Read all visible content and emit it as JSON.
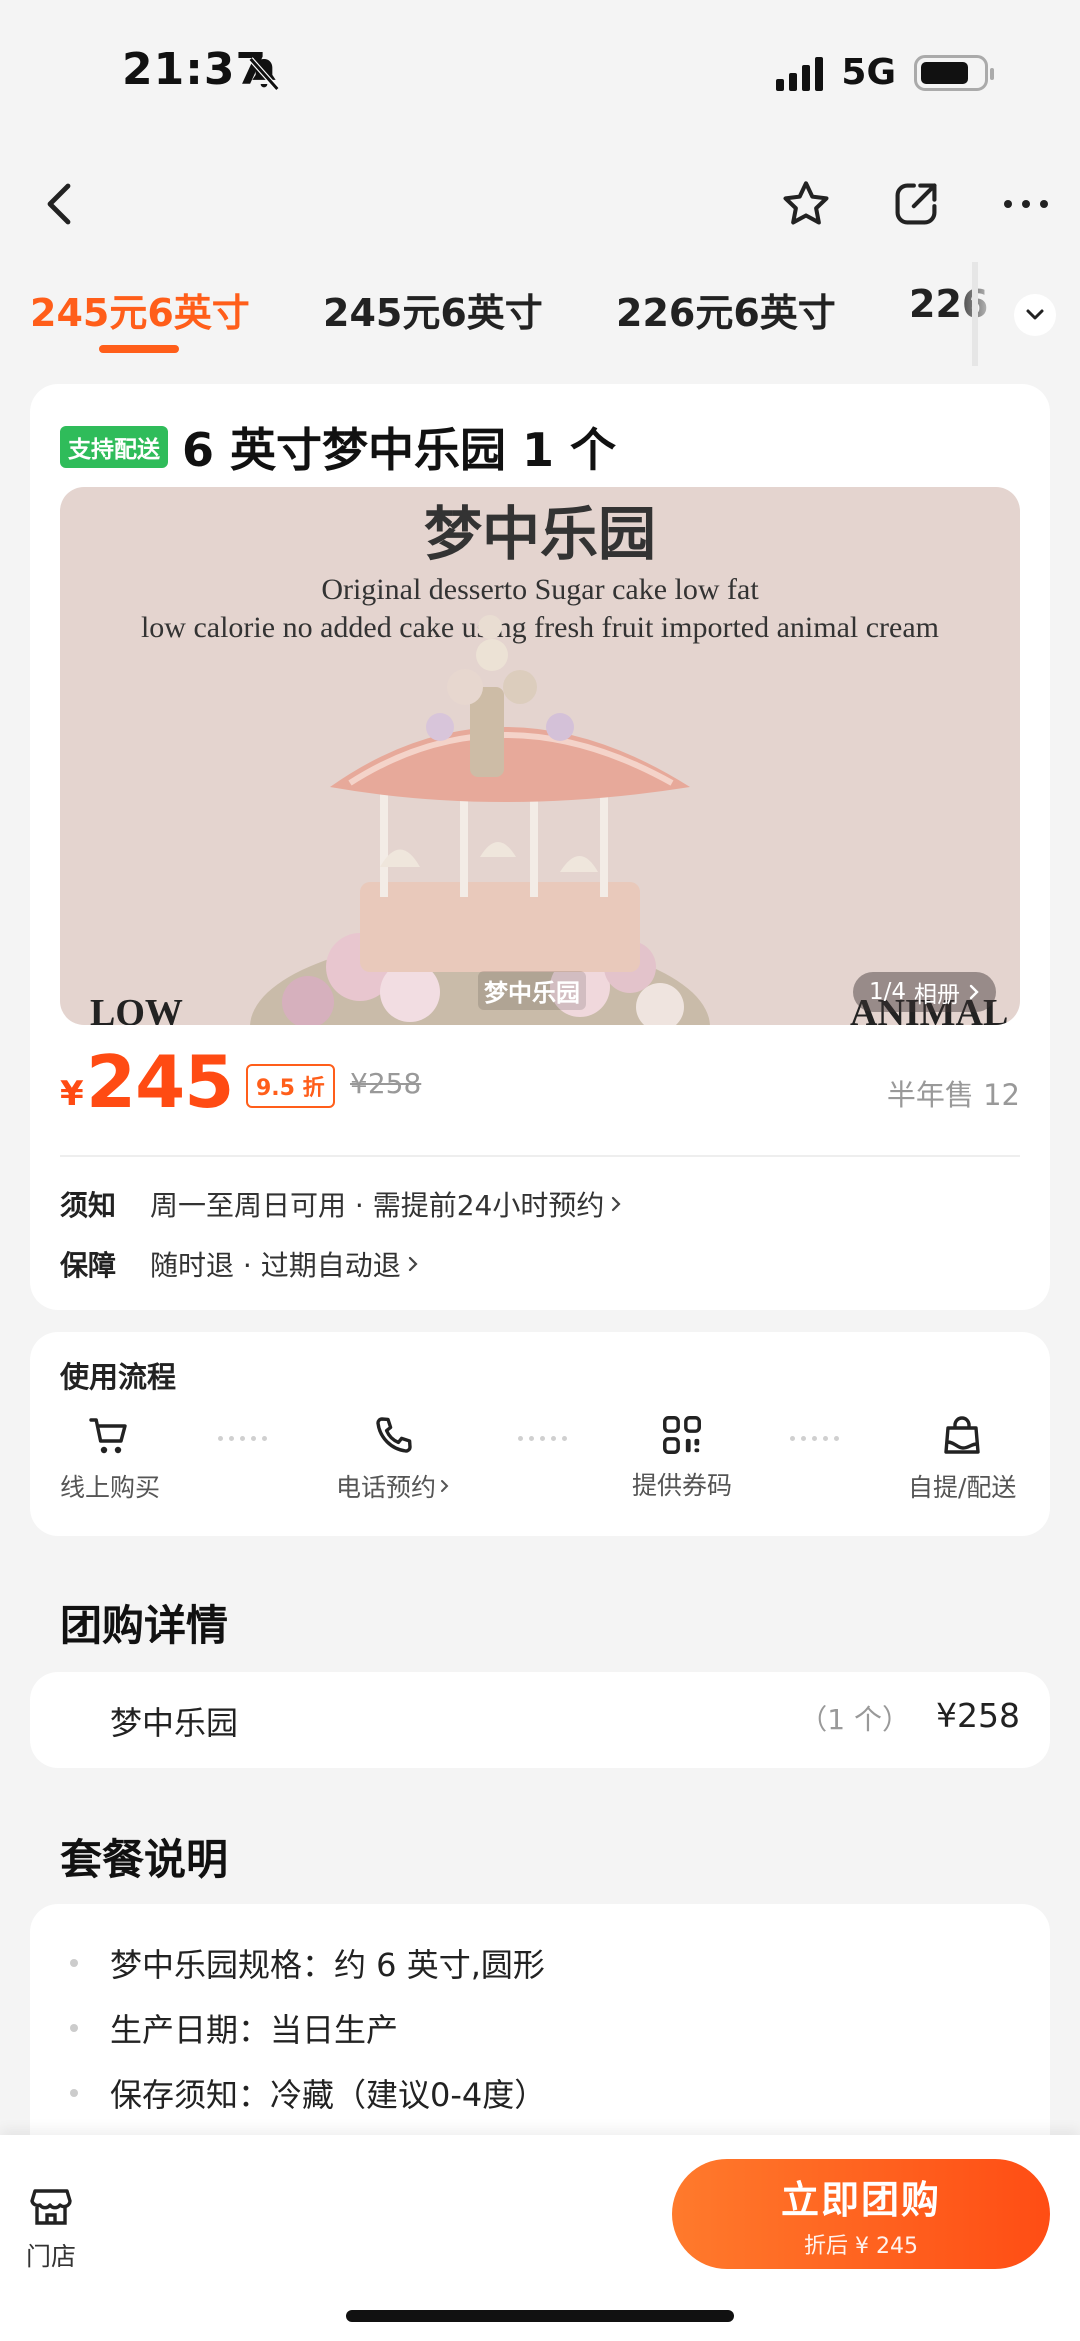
{
  "status_bar": {
    "time": "21:37",
    "network": "5G",
    "battery_level": 0.78
  },
  "tabs": [
    {
      "label": "245元6英寸",
      "active": true
    },
    {
      "label": "245元6英寸",
      "active": false
    },
    {
      "label": "226元6英寸",
      "active": false
    },
    {
      "label": "226",
      "active": false
    }
  ],
  "deal": {
    "tag": "支持配送",
    "title": "6 英寸梦中乐园 1 个",
    "image": {
      "title": "梦中乐园",
      "subtitle_line1": "Original desserto Sugar cake low fat",
      "subtitle_line2": "low calorie no added cake using fresh fruit imported animal cream",
      "corner_left": "LOW",
      "corner_right": "ANIMAL",
      "caption": "梦中乐园",
      "album_index": "1/4",
      "album_label": "相册"
    },
    "currency": "¥",
    "price": "245",
    "discount": "9.5 折",
    "original_price": "¥258",
    "sold": "半年售 12",
    "notice_label": "须知",
    "notice_text": "周一至周日可用 · 需提前24小时预约",
    "guarantee_label": "保障",
    "guarantee_text": "随时退 · 过期自动退"
  },
  "flow": {
    "title": "使用流程",
    "steps": [
      {
        "label": "线上购买",
        "icon": "cart-icon"
      },
      {
        "label": "电话预约",
        "icon": "phone-icon"
      },
      {
        "label": "提供券码",
        "icon": "qr-code-icon"
      },
      {
        "label": "自提/配送",
        "icon": "bag-icon"
      }
    ]
  },
  "group_detail": {
    "title": "团购详情",
    "item_name": "梦中乐园",
    "item_qty": "（1 个）",
    "item_price": "¥258"
  },
  "package": {
    "title": "套餐说明",
    "items": [
      "梦中乐园规格：约 6 英寸,圆形",
      "生产日期：当日生产",
      "保存须知：冷藏（建议0-4度）"
    ]
  },
  "bottom_bar": {
    "store_label": "门店",
    "buy_label": "立即团购",
    "buy_sub": "折后 ¥ 245"
  },
  "colors": {
    "accent": "#ff5e1a",
    "price": "#ff4b13",
    "tag_green": "#2fbc5a"
  }
}
